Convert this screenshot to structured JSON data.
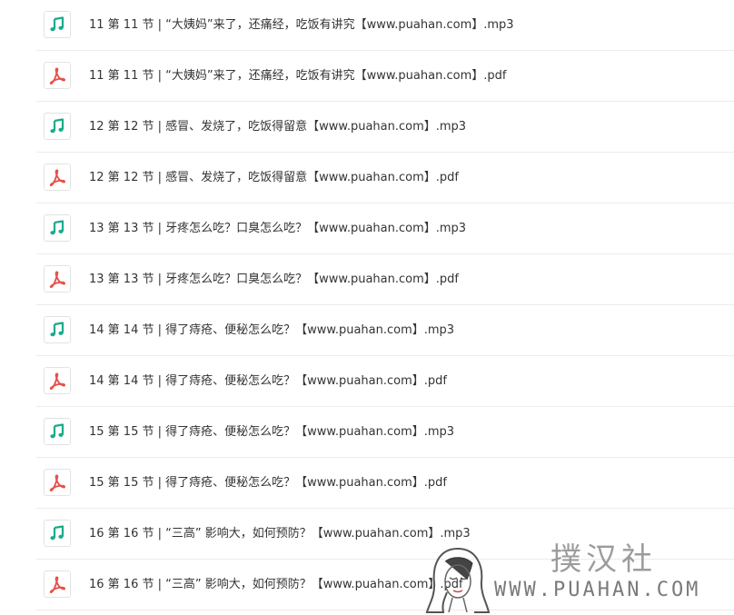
{
  "colors": {
    "audio": "#1aab8a",
    "pdf": "#e5524a",
    "divider": "#ececec",
    "text": "#333333"
  },
  "files": [
    {
      "name": "11 第 11 节 | “大姨妈”来了，还痛经，吃饭有讲究【www.puahan.com】.mp3",
      "type": "audio",
      "icon": "music-note-icon"
    },
    {
      "name": "11 第 11 节 | “大姨妈”来了，还痛经，吃饭有讲究【www.puahan.com】.pdf",
      "type": "pdf",
      "icon": "pdf-icon"
    },
    {
      "name": "12 第 12 节 | 感冒、发烧了，吃饭得留意【www.puahan.com】.mp3",
      "type": "audio",
      "icon": "music-note-icon"
    },
    {
      "name": "12 第 12 节 | 感冒、发烧了，吃饭得留意【www.puahan.com】.pdf",
      "type": "pdf",
      "icon": "pdf-icon"
    },
    {
      "name": "13 第 13 节 | 牙疼怎么吃？口臭怎么吃？【www.puahan.com】.mp3",
      "type": "audio",
      "icon": "music-note-icon"
    },
    {
      "name": "13 第 13 节 | 牙疼怎么吃？口臭怎么吃？【www.puahan.com】.pdf",
      "type": "pdf",
      "icon": "pdf-icon"
    },
    {
      "name": "14 第 14 节 | 得了痔疮、便秘怎么吃？【www.puahan.com】.mp3",
      "type": "audio",
      "icon": "music-note-icon"
    },
    {
      "name": "14 第 14 节 | 得了痔疮、便秘怎么吃？【www.puahan.com】.pdf",
      "type": "pdf",
      "icon": "pdf-icon"
    },
    {
      "name": "15 第 15 节 | 得了痔疮、便秘怎么吃？【www.puahan.com】.mp3",
      "type": "audio",
      "icon": "music-note-icon"
    },
    {
      "name": "15 第 15 节 | 得了痔疮、便秘怎么吃？【www.puahan.com】.pdf",
      "type": "pdf",
      "icon": "pdf-icon"
    },
    {
      "name": "16 第 16 节 | “三高” 影响大，如何预防？【www.puahan.com】.mp3",
      "type": "audio",
      "icon": "music-note-icon"
    },
    {
      "name": "16 第 16 节 | “三高” 影响大，如何预防？【www.puahan.com】.pdf",
      "type": "pdf",
      "icon": "pdf-icon"
    }
  ],
  "watermark": {
    "chinese": "撲汉社",
    "english": "WWW.PUAHAN.COM",
    "icon": "woman-face-icon"
  }
}
